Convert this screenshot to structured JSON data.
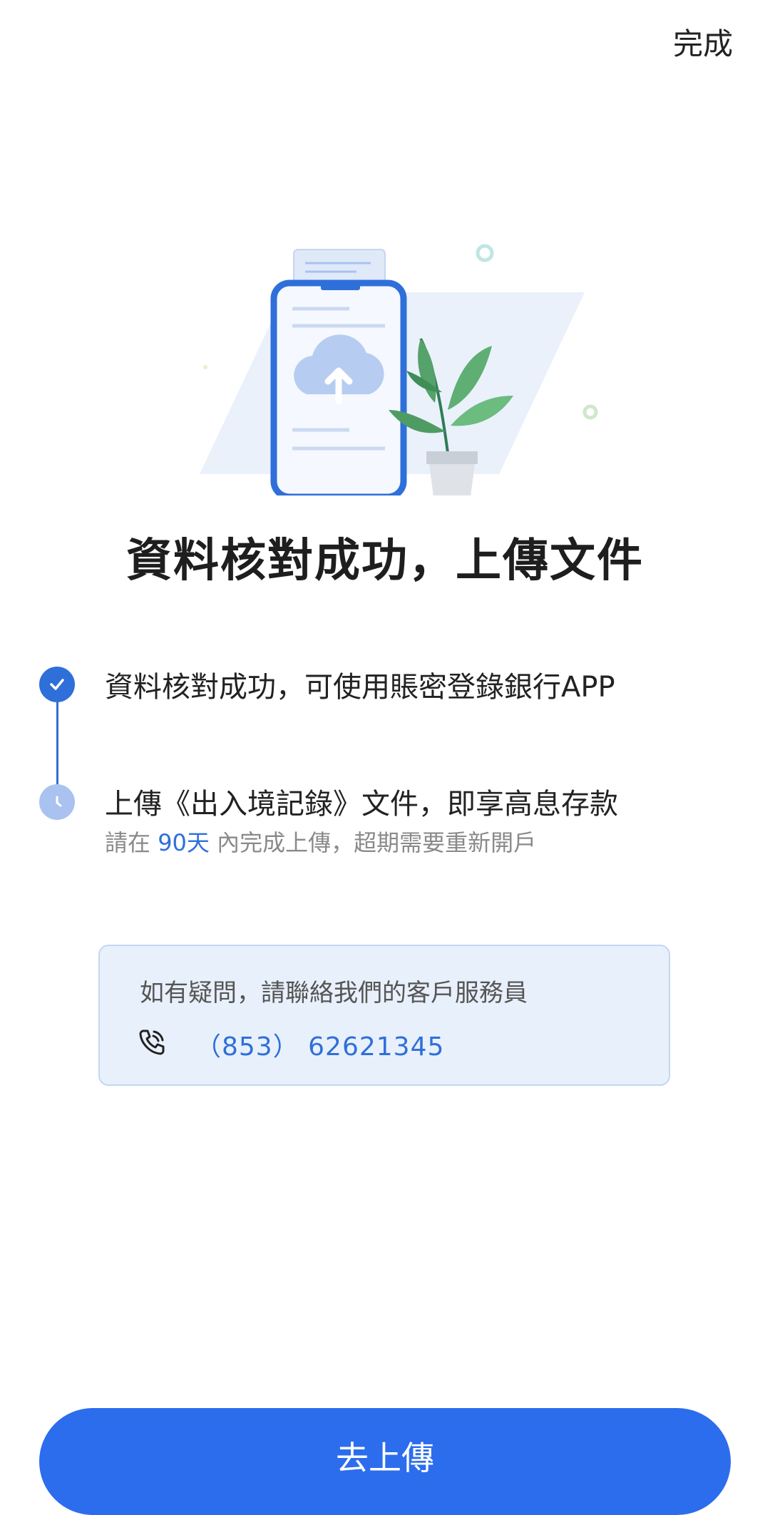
{
  "header": {
    "done_label": "完成"
  },
  "illustration": {
    "icon": "upload-cloud-phone-plant-illustration"
  },
  "title": "資料核對成功，上傳文件",
  "steps": [
    {
      "text": "資料核對成功，可使用賬密登錄銀行APP",
      "status": "done",
      "icon": "check-icon"
    },
    {
      "text": "上傳《出入境記錄》文件，即享高息存款",
      "status": "pending",
      "icon": "clock-icon",
      "sub_prefix": "請在 ",
      "sub_highlight": "90天",
      "sub_suffix": " 內完成上傳，超期需要重新開戶"
    }
  ],
  "contact": {
    "question": "如有疑問，請聯絡我們的客戶服務員",
    "icon": "phone-icon",
    "phone": "（853） 62621345"
  },
  "button": {
    "label": "去上傳"
  },
  "colors": {
    "accent": "#2c6ded",
    "box_bg": "#e8f0fb",
    "pending": "#a9c2ef"
  }
}
